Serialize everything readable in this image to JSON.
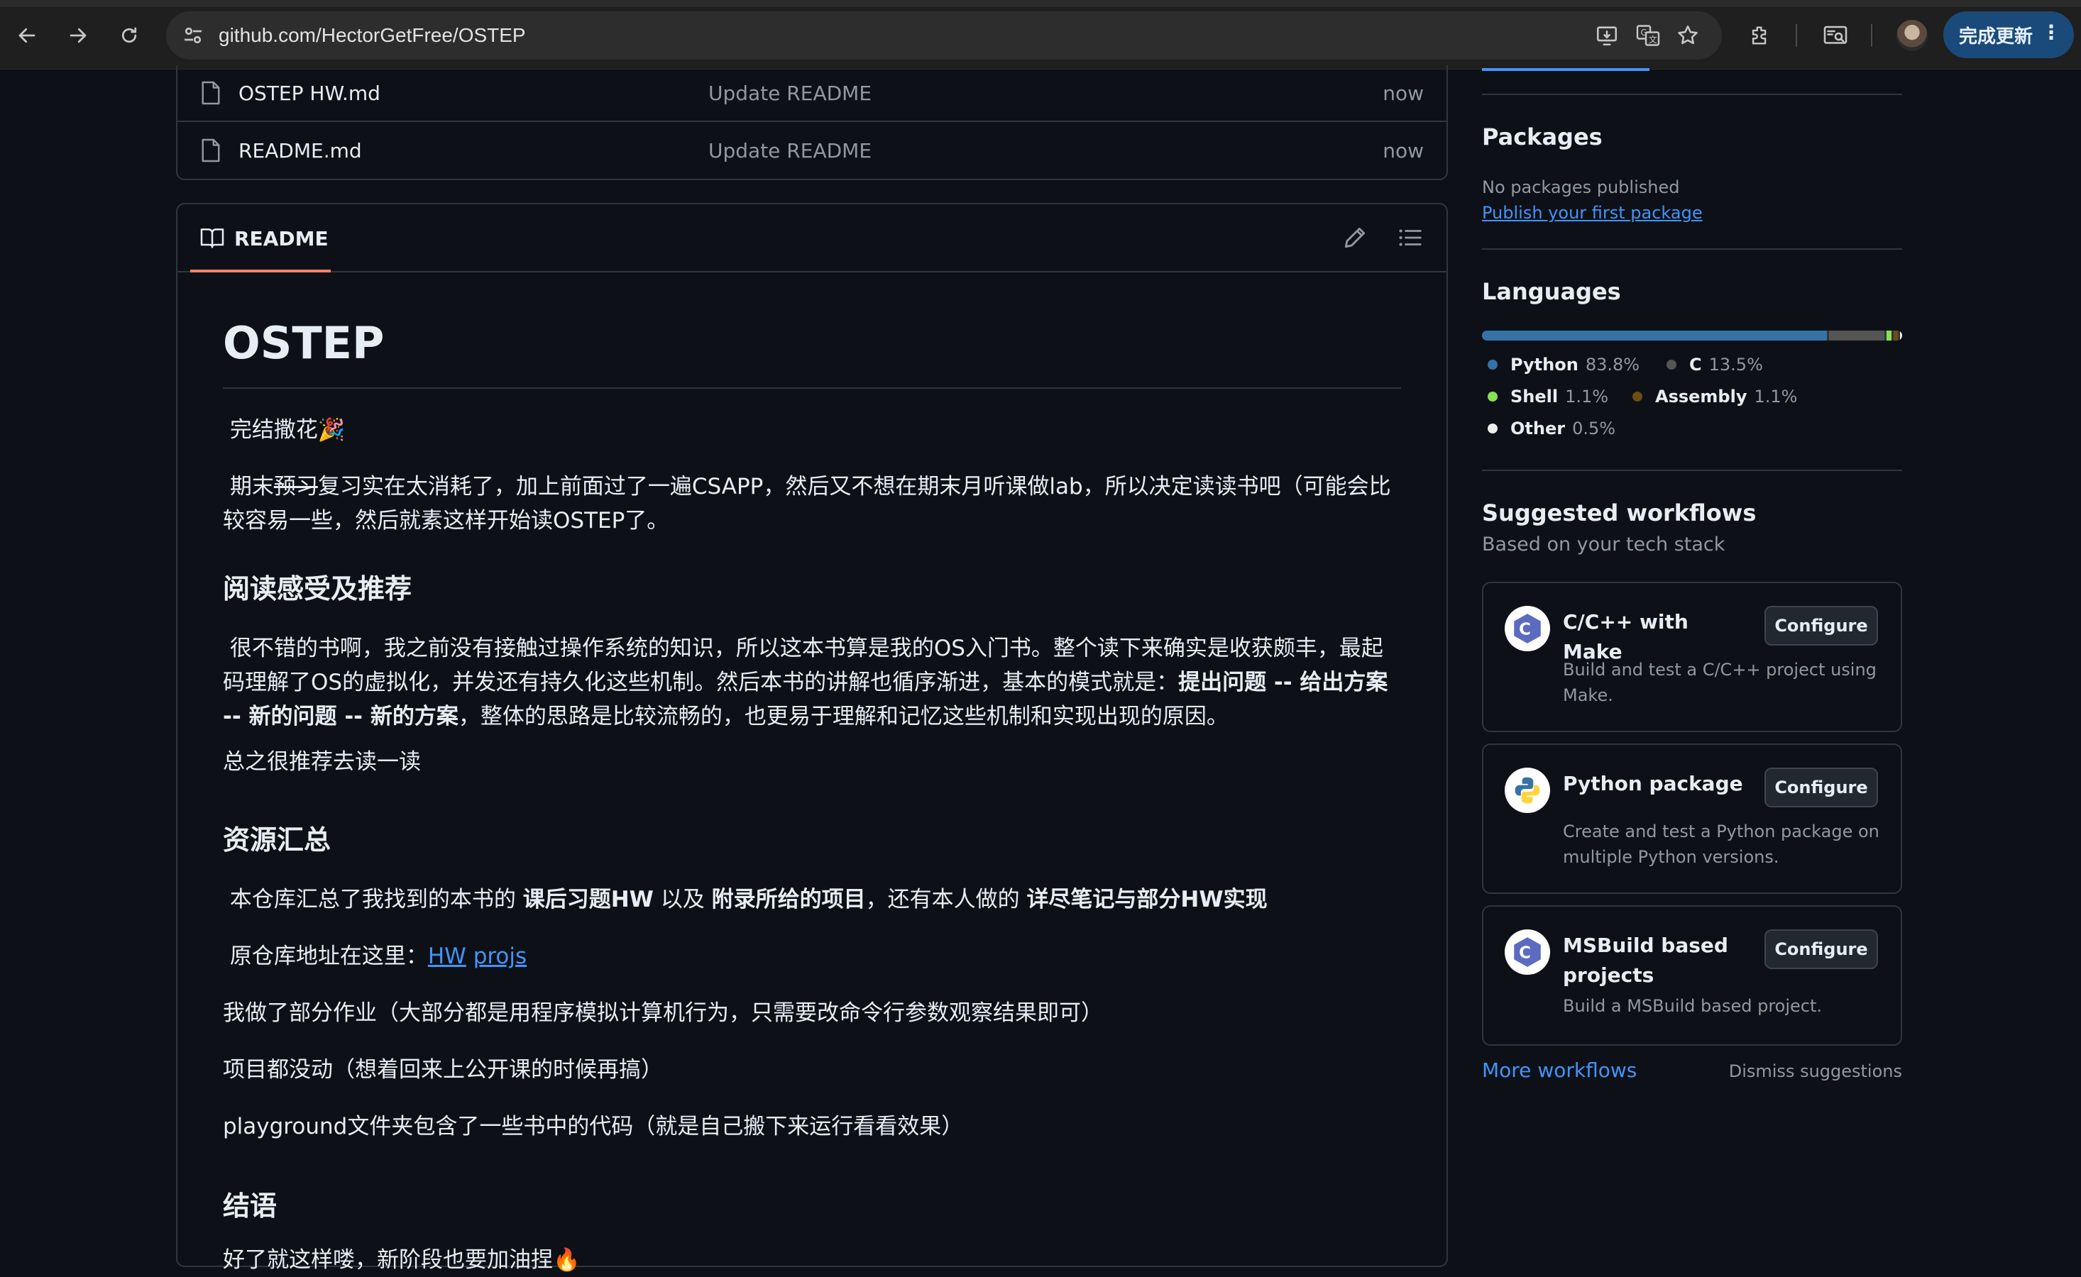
{
  "browser": {
    "url": "github.com/HectorGetFree/OSTEP",
    "update_label": "完成更新"
  },
  "files": [
    {
      "name": "OSTEP HW.md",
      "message": "Update README",
      "time": "now"
    },
    {
      "name": "README.md",
      "message": "Update README",
      "time": "now"
    }
  ],
  "readme": {
    "tab_label": "README",
    "title": "OSTEP",
    "p1": "完结撒花🎉",
    "p2a": "期末",
    "p2_strike": "预习",
    "p2b": "复习实在太消耗了，加上前面过了一遍CSAPP，然后又不想在期末月听课做lab，所以决定读读书吧（可能会比较容易一些，然后就素这样开始读OSTEP了。",
    "h2_1": "阅读感受及推荐",
    "p3a": "很不错的书啊，我之前没有接触过操作系统的知识，所以这本书算是我的OS入门书。整个读下来确实是收获颇丰，最起码理解了OS的虚拟化，并发还有持久化这些机制。然后本书的讲解也循序渐进，基本的模式就是：",
    "p3_bold": "提出问题 -- 给出方案 -- 新的问题 -- 新的方案",
    "p3b": "，整体的思路是比较流畅的，也更易于理解和记忆这些机制和实现出现的原因。",
    "p4": "总之很推荐去读一读",
    "h2_2": "资源汇总",
    "p5a": "本仓库汇总了我找到的本书的 ",
    "p5_b1": "课后习题HW",
    "p5b": " 以及 ",
    "p5_b2": "附录所给的项目",
    "p5c": "，还有本人做的 ",
    "p5_b3": "详尽笔记与部分HW实现",
    "p6a": "原仓库地址在这里：",
    "p6_link1": "HW",
    "p6_link2": "projs",
    "p7": "我做了部分作业（大部分都是用程序模拟计算机行为，只需要改命令行参数观察结果即可）",
    "p8": "项目都没动（想着回来上公开课的时候再搞）",
    "p9": "playground文件夹包含了一些书中的代码（就是自己搬下来运行看看效果）",
    "h2_3": "结语",
    "p10": "好了就这样喽，新阶段也要加油捏🔥"
  },
  "sidebar": {
    "packages_title": "Packages",
    "packages_empty": "No packages published",
    "packages_link": "Publish your first package",
    "languages_title": "Languages",
    "languages": [
      {
        "name": "Python",
        "pct": "83.8%",
        "value": 83.8,
        "color": "#3572A5"
      },
      {
        "name": "C",
        "pct": "13.5%",
        "value": 13.5,
        "color": "#555555"
      },
      {
        "name": "Shell",
        "pct": "1.1%",
        "value": 1.1,
        "color": "#89e051"
      },
      {
        "name": "Assembly",
        "pct": "1.1%",
        "value": 1.1,
        "color": "#6E4C13"
      },
      {
        "name": "Other",
        "pct": "0.5%",
        "value": 0.5,
        "color": "#ededed"
      }
    ],
    "workflows_title": "Suggested workflows",
    "workflows_sub": "Based on your tech stack",
    "workflows": [
      {
        "title": "C/C++ with Make",
        "desc": "Build and test a C/C++ project using Make.",
        "button": "Configure"
      },
      {
        "title": "Python package",
        "desc": "Create and test a Python package on multiple Python versions.",
        "button": "Configure"
      },
      {
        "title": "MSBuild based projects",
        "desc": "Build a MSBuild based project.",
        "button": "Configure"
      }
    ],
    "more_workflows": "More workflows",
    "dismiss": "Dismiss suggestions"
  }
}
